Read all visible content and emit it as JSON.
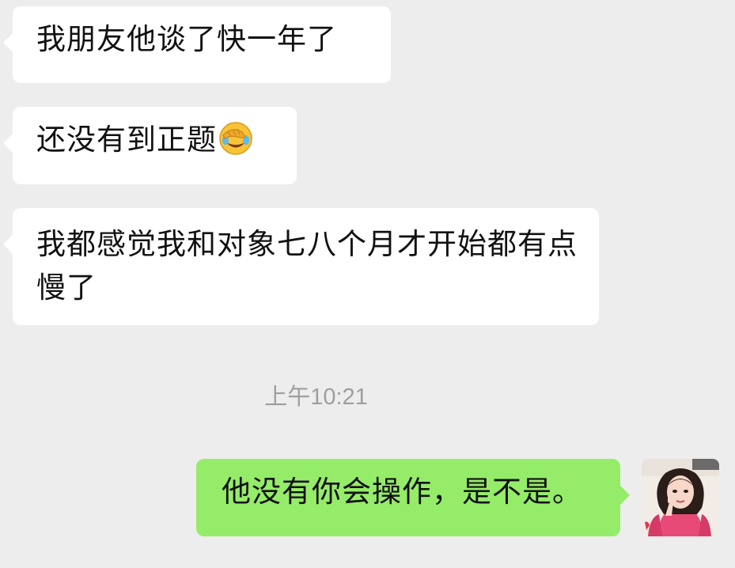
{
  "messages": [
    {
      "direction": "incoming",
      "text": "我朋友他谈了快一年了"
    },
    {
      "direction": "incoming",
      "text": "还没有到正题",
      "emoji": "facepalm-laughing-emoji"
    },
    {
      "direction": "incoming",
      "text": "我都感觉我和对象七八个月才开始都有点慢了"
    },
    {
      "direction": "outgoing",
      "text": "他没有你会操作，是不是。"
    }
  ],
  "timestamp": "上午10:21",
  "colors": {
    "background": "#ededed",
    "incoming_bubble": "#ffffff",
    "outgoing_bubble": "#95ec69",
    "timestamp_text": "#9e9e9e"
  }
}
